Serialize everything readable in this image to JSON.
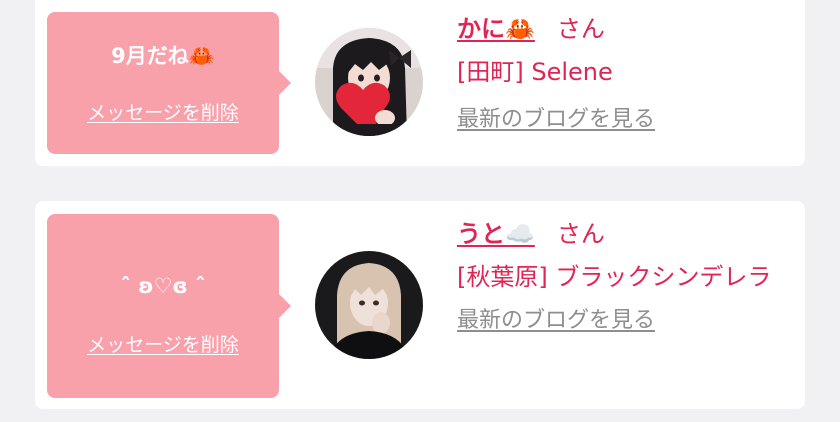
{
  "messages": [
    {
      "bubble_text": "9月だね🦀",
      "delete_label": "メッセージを削除",
      "name": "かに🦀",
      "honorific": "さん",
      "shop_line": "[田町] Selene",
      "blog_label": "最新のブログを見る",
      "avatar_icon": "girl-with-heart-photo"
    },
    {
      "bubble_text": "ˆ ʚ♡ɞ ˆ",
      "delete_label": "メッセージを削除",
      "name": "うと☁️",
      "honorific": "さん",
      "shop_line": "[秋葉原] ブラックシンデレラ",
      "blog_label": "最新のブログを見る",
      "avatar_icon": "blonde-girl-photo"
    }
  ],
  "colors": {
    "page_bg": "#f1f1f3",
    "card_bg": "#ffffff",
    "bubble_bg": "#f8a1ab",
    "accent": "#e02554",
    "muted_link": "#8e8e8e"
  }
}
